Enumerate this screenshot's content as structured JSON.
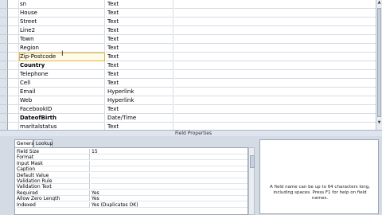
{
  "fields": [
    {
      "name": "sn",
      "type": "Text",
      "bold": false
    },
    {
      "name": "House",
      "type": "Text",
      "bold": false
    },
    {
      "name": "Street",
      "type": "Text",
      "bold": false
    },
    {
      "name": "Line2",
      "type": "Text",
      "bold": false
    },
    {
      "name": "Town",
      "type": "Text",
      "bold": false
    },
    {
      "name": "Region",
      "type": "Text",
      "bold": false
    },
    {
      "name": "Zip-Postcode",
      "type": "Text",
      "bold": false,
      "active": true
    },
    {
      "name": "Country",
      "type": "Text",
      "bold": true
    },
    {
      "name": "Telephone",
      "type": "Text",
      "bold": false
    },
    {
      "name": "Cell",
      "type": "Text",
      "bold": false
    },
    {
      "name": "Email",
      "type": "Hyperlink",
      "bold": false
    },
    {
      "name": "Web",
      "type": "Hyperlink",
      "bold": false
    },
    {
      "name": "FacebookID",
      "type": "Text",
      "bold": false
    },
    {
      "name": "DateofBirth",
      "type": "Date/Time",
      "bold": true
    },
    {
      "name": "maritalstatus",
      "type": "Text",
      "bold": false
    }
  ],
  "field_properties_label": "Field Properties",
  "tabs": [
    "General",
    "Lookup"
  ],
  "properties": [
    {
      "name": "Field Size",
      "value": "15"
    },
    {
      "name": "Format",
      "value": ""
    },
    {
      "name": "Input Mask",
      "value": ""
    },
    {
      "name": "Caption",
      "value": ""
    },
    {
      "name": "Default Value",
      "value": ""
    },
    {
      "name": "Validation Rule",
      "value": ""
    },
    {
      "name": "Validation Text",
      "value": ""
    },
    {
      "name": "Required",
      "value": "Yes"
    },
    {
      "name": "Allow Zero Length",
      "value": "Yes"
    },
    {
      "name": "Indexed",
      "value": "Yes (Duplicates OK)"
    }
  ],
  "help_text": "A field name can be up to 64 characters long, including spaces. Press F1 for help on field names.",
  "icons": {
    "scroll_up": "arrow-up-icon",
    "scroll_down": "arrow-down-icon",
    "text_cursor": "ibeam-cursor-icon"
  }
}
